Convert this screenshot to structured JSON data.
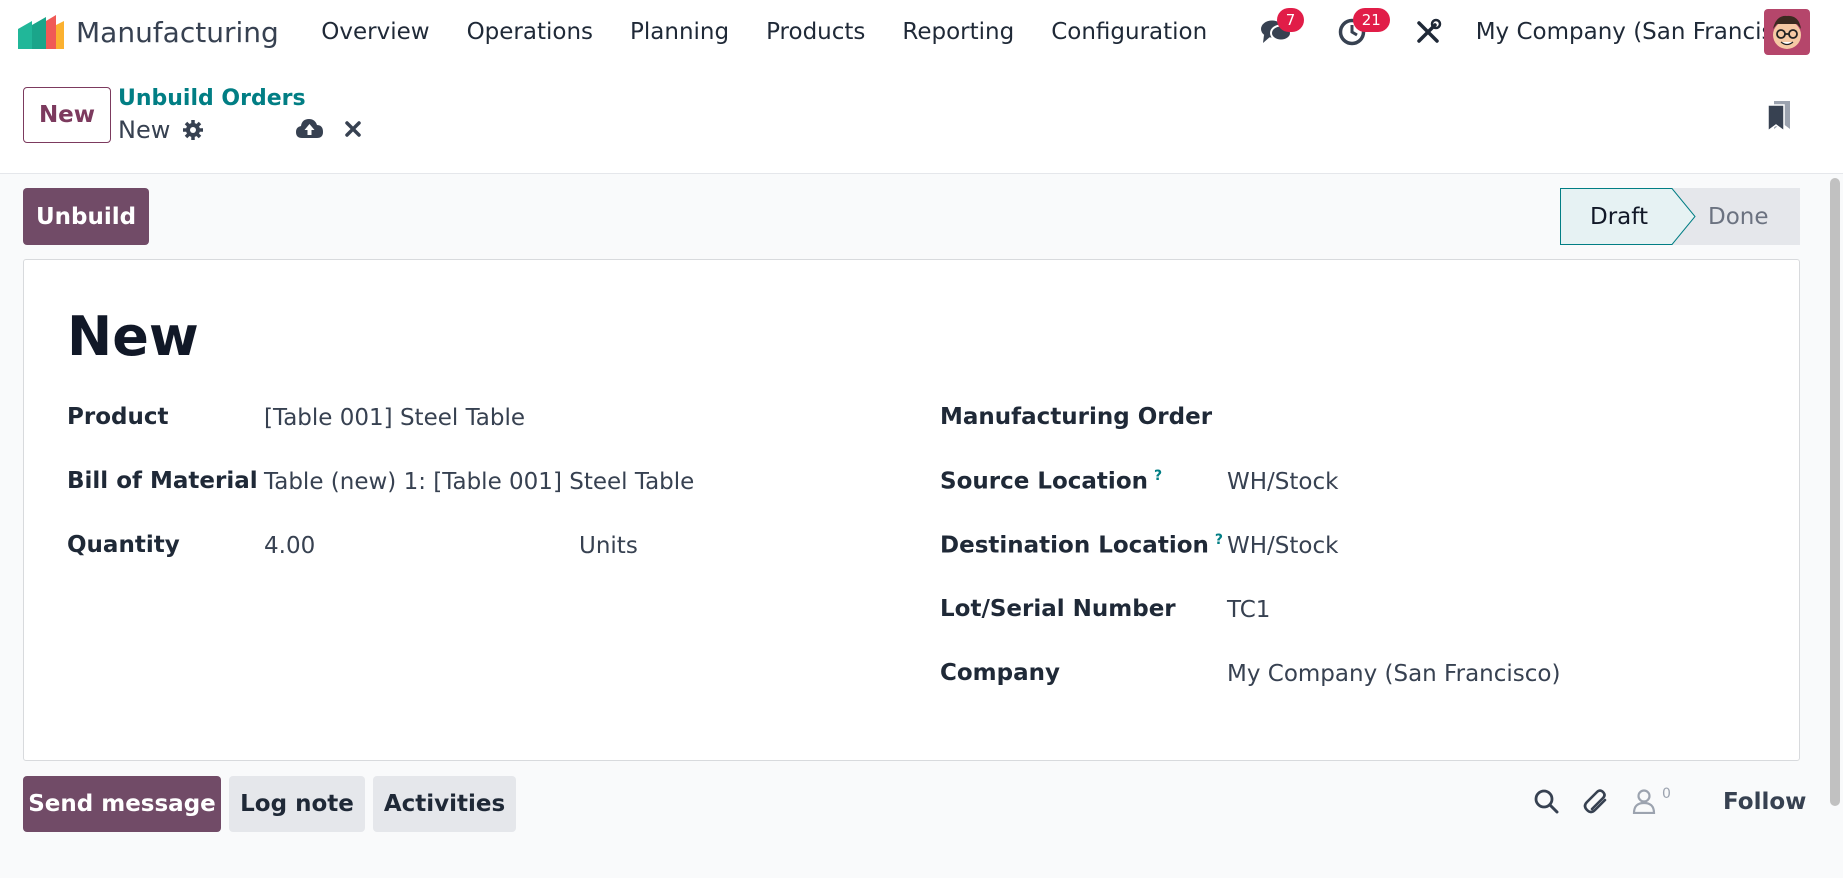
{
  "navbar": {
    "app_name": "Manufacturing",
    "menu": [
      "Overview",
      "Operations",
      "Planning",
      "Products",
      "Reporting",
      "Configuration"
    ],
    "messages_count": "7",
    "activities_count": "21",
    "company": "My Company (San Francisco)"
  },
  "control": {
    "new_label": "New",
    "breadcrumb": "Unbuild Orders",
    "record": "New"
  },
  "status": {
    "action_label": "Unbuild",
    "stages": [
      "Draft",
      "Done"
    ],
    "current_stage": "Draft"
  },
  "form": {
    "title": "New",
    "left": [
      {
        "label": "Product",
        "value": "[Table 001] Steel Table"
      },
      {
        "label": "Bill of Material",
        "value": "Table (new) 1: [Table 001] Steel Table"
      },
      {
        "label": "Quantity",
        "value": "4.00",
        "unit": "Units"
      }
    ],
    "right": [
      {
        "label": "Manufacturing Order",
        "value": ""
      },
      {
        "label": "Source Location",
        "value": "WH/Stock",
        "help": "?"
      },
      {
        "label": "Destination Location",
        "value": "WH/Stock",
        "help": "?"
      },
      {
        "label": "Lot/Serial Number",
        "value": "TC1"
      },
      {
        "label": "Company",
        "value": "My Company (San Francisco)"
      }
    ]
  },
  "chatter": {
    "send_label": "Send message",
    "log_label": "Log note",
    "activities_label": "Activities",
    "followers_count": "0",
    "follow_label": "Follow"
  },
  "colors": {
    "brand": "#714b67",
    "accent": "#017e84",
    "badge": "#e11d48"
  }
}
